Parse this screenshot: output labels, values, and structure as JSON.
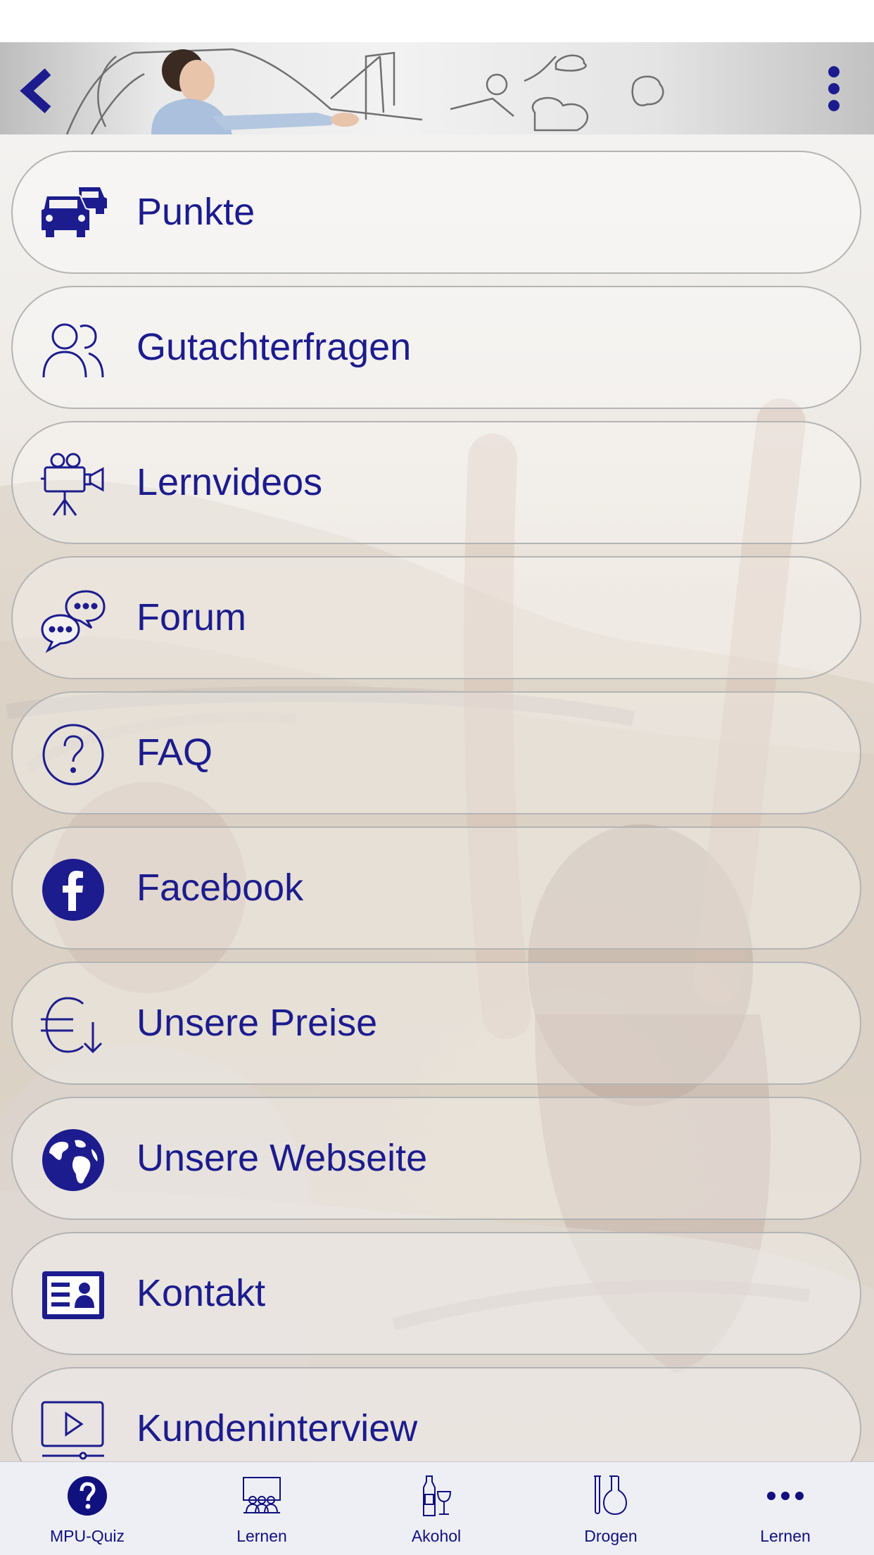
{
  "theme": {
    "accent": "#1c1c8e",
    "tab_color": "#10107f",
    "border": "#b4b4b4"
  },
  "header": {
    "back_icon": "chevron-left-icon",
    "more_icon": "vertical-ellipsis-icon"
  },
  "menu": {
    "items": [
      {
        "label": "Punkte",
        "icon": "cars-icon"
      },
      {
        "label": "Gutachterfragen",
        "icon": "users-icon"
      },
      {
        "label": "Lernvideos",
        "icon": "movie-camera-icon"
      },
      {
        "label": "Forum",
        "icon": "chat-bubbles-icon"
      },
      {
        "label": "FAQ",
        "icon": "question-circle-icon"
      },
      {
        "label": "Facebook",
        "icon": "facebook-icon"
      },
      {
        "label": "Unsere Preise",
        "icon": "euro-price-icon"
      },
      {
        "label": "Unsere Webseite",
        "icon": "globe-icon"
      },
      {
        "label": "Kontakt",
        "icon": "contact-card-icon"
      },
      {
        "label": "Kundeninterview",
        "icon": "video-player-icon"
      }
    ]
  },
  "tabs": [
    {
      "label": "MPU-Quiz",
      "icon": "question-circle-filled-icon"
    },
    {
      "label": "Lernen",
      "icon": "classroom-icon"
    },
    {
      "label": "Akohol",
      "icon": "bottle-glass-icon"
    },
    {
      "label": "Drogen",
      "icon": "lab-flasks-icon"
    },
    {
      "label": "Lernen",
      "icon": "more-dots-icon"
    }
  ]
}
